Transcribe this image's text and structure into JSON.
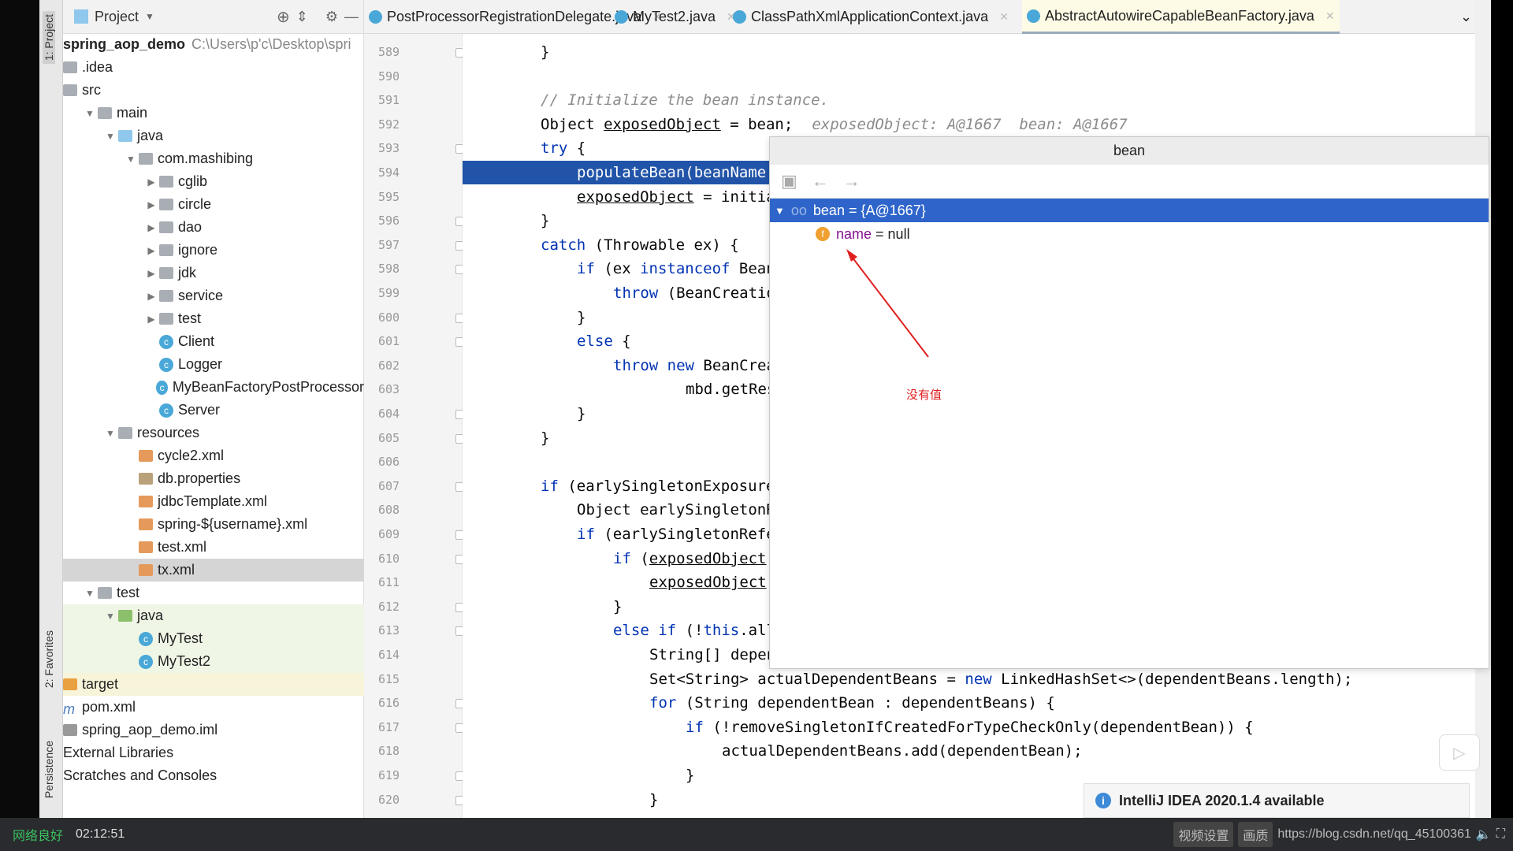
{
  "project_panel": {
    "title": "Project",
    "root_name": "spring_aop_demo",
    "root_path": "C:\\Users\\p'c\\Desktop\\spri",
    "items": [
      {
        "label": ".idea",
        "depth": 0,
        "icon": "folder-icon",
        "arrow": ""
      },
      {
        "label": "src",
        "depth": 0,
        "icon": "folder-icon",
        "arrow": ""
      },
      {
        "label": "main",
        "depth": 1,
        "icon": "folder-icon",
        "arrow": "down"
      },
      {
        "label": "java",
        "depth": 2,
        "icon": "source-folder-icon",
        "arrow": "down"
      },
      {
        "label": "com.mashibing",
        "depth": 3,
        "icon": "package-icon",
        "arrow": "down"
      },
      {
        "label": "cglib",
        "depth": 4,
        "icon": "package-icon",
        "arrow": "right"
      },
      {
        "label": "circle",
        "depth": 4,
        "icon": "package-icon",
        "arrow": "right"
      },
      {
        "label": "dao",
        "depth": 4,
        "icon": "package-icon",
        "arrow": "right"
      },
      {
        "label": "ignore",
        "depth": 4,
        "icon": "package-icon",
        "arrow": "right"
      },
      {
        "label": "jdk",
        "depth": 4,
        "icon": "package-icon",
        "arrow": "right"
      },
      {
        "label": "service",
        "depth": 4,
        "icon": "package-icon",
        "arrow": "right"
      },
      {
        "label": "test",
        "depth": 4,
        "icon": "package-icon",
        "arrow": "right"
      },
      {
        "label": "Client",
        "depth": 4,
        "icon": "class-icon",
        "arrow": "none"
      },
      {
        "label": "Logger",
        "depth": 4,
        "icon": "class-icon",
        "arrow": "none"
      },
      {
        "label": "MyBeanFactoryPostProcessor",
        "depth": 4,
        "icon": "class-icon",
        "arrow": "none"
      },
      {
        "label": "Server",
        "depth": 4,
        "icon": "class-icon",
        "arrow": "none"
      },
      {
        "label": "resources",
        "depth": 2,
        "icon": "resources-folder-icon",
        "arrow": "down"
      },
      {
        "label": "cycle2.xml",
        "depth": 3,
        "icon": "xml-file-icon",
        "arrow": "none"
      },
      {
        "label": "db.properties",
        "depth": 3,
        "icon": "properties-file-icon",
        "arrow": "none"
      },
      {
        "label": "jdbcTemplate.xml",
        "depth": 3,
        "icon": "xml-file-icon",
        "arrow": "none"
      },
      {
        "label": "spring-${username}.xml",
        "depth": 3,
        "icon": "xml-file-icon",
        "arrow": "none"
      },
      {
        "label": "test.xml",
        "depth": 3,
        "icon": "xml-file-icon",
        "arrow": "none"
      },
      {
        "label": "tx.xml",
        "depth": 3,
        "icon": "xml-file-icon",
        "arrow": "none",
        "selected": true
      },
      {
        "label": "test",
        "depth": 1,
        "icon": "folder-icon",
        "arrow": "down"
      },
      {
        "label": "java",
        "depth": 2,
        "icon": "test-folder-icon",
        "arrow": "down",
        "bg": "green"
      },
      {
        "label": "MyTest",
        "depth": 3,
        "icon": "class-icon",
        "arrow": "none",
        "bg": "green"
      },
      {
        "label": "MyTest2",
        "depth": 3,
        "icon": "class-icon",
        "arrow": "none",
        "bg": "green"
      },
      {
        "label": "target",
        "depth": 0,
        "icon": "excluded-folder-icon",
        "arrow": "",
        "bg": "yellow"
      },
      {
        "label": "pom.xml",
        "depth": 0,
        "icon": "maven-icon",
        "arrow": ""
      },
      {
        "label": "spring_aop_demo.iml",
        "depth": 0,
        "icon": "module-file-icon",
        "arrow": ""
      },
      {
        "label": "External Libraries",
        "depth": -1,
        "icon": "",
        "arrow": ""
      },
      {
        "label": "Scratches and Consoles",
        "depth": -1,
        "icon": "",
        "arrow": ""
      }
    ]
  },
  "tool_strip": {
    "project": "1: Project",
    "favorites": "2: Favorites",
    "persistence": "Persistence"
  },
  "tabs": [
    {
      "label": "PostProcessorRegistrationDelegate.java",
      "active": false
    },
    {
      "label": "MyTest2.java",
      "active": false
    },
    {
      "label": "ClassPathXmlApplicationContext.java",
      "active": false
    },
    {
      "label": "AbstractAutowireCapableBeanFactory.java",
      "active": true
    }
  ],
  "editor": {
    "lines": [
      {
        "n": "589",
        "i": 0,
        "t": "}"
      },
      {
        "n": "590",
        "i": 0,
        "t": ""
      },
      {
        "n": "591",
        "i": 0,
        "t": "// Initialize the bean instance.",
        "c": true
      },
      {
        "n": "592",
        "i": 0,
        "t": "Object exposedObject = bean;",
        "hint": "exposedObject: A@1667  bean: A@1667"
      },
      {
        "n": "593",
        "i": 0,
        "t": "try {"
      },
      {
        "n": "594",
        "i": 1,
        "t": "populateBean(beanName, mbd, instanceWrapper);",
        "hl": true
      },
      {
        "n": "595",
        "i": 1,
        "t": "exposedObject = initializeBean(beanName, exposedObject, mbd);"
      },
      {
        "n": "596",
        "i": 0,
        "t": "}"
      },
      {
        "n": "597",
        "i": 0,
        "t": "catch (Throwable ex) {"
      },
      {
        "n": "598",
        "i": 1,
        "t": "if (ex instanceof BeanCreationException && beanName.equals(((BeanCreationException) ex).getBeanName())) {"
      },
      {
        "n": "599",
        "i": 2,
        "t": "throw (BeanCreationException) ex;"
      },
      {
        "n": "600",
        "i": 1,
        "t": "}"
      },
      {
        "n": "601",
        "i": 1,
        "t": "else {"
      },
      {
        "n": "602",
        "i": 2,
        "t": "throw new BeanCreationException("
      },
      {
        "n": "603",
        "i": 4,
        "t": "mbd.getResourceDescription(), beanName, \"Initialization of bean failed\", ex);"
      },
      {
        "n": "604",
        "i": 1,
        "t": "}"
      },
      {
        "n": "605",
        "i": 0,
        "t": "}"
      },
      {
        "n": "606",
        "i": 0,
        "t": ""
      },
      {
        "n": "607",
        "i": 0,
        "t": "if (earlySingletonExposure) {"
      },
      {
        "n": "608",
        "i": 1,
        "t": "Object earlySingletonReference = getSingleton(beanName, false);"
      },
      {
        "n": "609",
        "i": 1,
        "t": "if (earlySingletonReference != null) {"
      },
      {
        "n": "610",
        "i": 2,
        "t": "if (exposedObject == bean) {"
      },
      {
        "n": "611",
        "i": 3,
        "t": "exposedObject = earlySingletonReference;"
      },
      {
        "n": "612",
        "i": 2,
        "t": "}"
      },
      {
        "n": "613",
        "i": 2,
        "t": "else if (!this.allowRawInjectionDespiteWrapping && hasDependentBean(beanName)) {"
      },
      {
        "n": "614",
        "i": 3,
        "t": "String[] dependentBeans = getDependentBeans(beanName);"
      },
      {
        "n": "615",
        "i": 3,
        "t": "Set<String> actualDependentBeans = new LinkedHashSet<>(dependentBeans.length);"
      },
      {
        "n": "616",
        "i": 3,
        "t": "for (String dependentBean : dependentBeans) {"
      },
      {
        "n": "617",
        "i": 4,
        "t": "if (!removeSingletonIfCreatedForTypeCheckOnly(dependentBean)) {"
      },
      {
        "n": "618",
        "i": 5,
        "t": "actualDependentBeans.add(dependentBean);"
      },
      {
        "n": "619",
        "i": 4,
        "t": "}"
      },
      {
        "n": "620",
        "i": 3,
        "t": "}"
      }
    ]
  },
  "popup": {
    "title": "bean",
    "root": "bean = {A@1667}",
    "field_name": "name",
    "field_eq": " = ",
    "field_value": "null"
  },
  "annotation": "没有值",
  "notification": "IntelliJ IDEA 2020.1.4 available",
  "status": {
    "network": "网络良好",
    "time": "02:12:51",
    "settings": "视频设置",
    "quality": "画质",
    "url": "https://blog.csdn.net/qq_45100361"
  },
  "colors": {
    "keyword": "#0033b3",
    "selection": "#2154a8",
    "popup_selection": "#2f65ca",
    "annotation": "#e02020"
  }
}
